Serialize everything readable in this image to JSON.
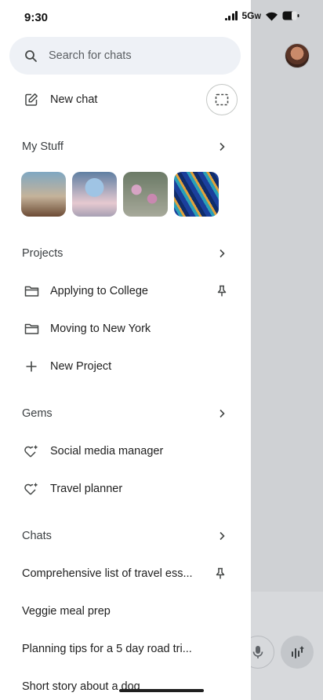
{
  "status_bar": {
    "time": "9:30",
    "network": "5G",
    "network_suffix": "W"
  },
  "search": {
    "placeholder": "Search for chats"
  },
  "new_chat": {
    "label": "New chat"
  },
  "my_stuff": {
    "title": "My Stuff",
    "thumbnails": [
      "hummingbird-image",
      "portrait-image",
      "flowers-image",
      "peacock-feather-image"
    ]
  },
  "projects": {
    "title": "Projects",
    "items": [
      {
        "label": "Applying to College",
        "pinned": true
      },
      {
        "label": "Moving to New York",
        "pinned": false
      }
    ],
    "new_label": "New Project"
  },
  "gems": {
    "title": "Gems",
    "items": [
      {
        "label": "Social media manager"
      },
      {
        "label": "Travel planner"
      }
    ]
  },
  "chats": {
    "title": "Chats",
    "items": [
      {
        "label": "Comprehensive list of travel ess...",
        "pinned": true
      },
      {
        "label": "Veggie meal prep",
        "pinned": false
      },
      {
        "label": "Planning tips for a 5 day road tri...",
        "pinned": false
      },
      {
        "label": "Short story about a dog",
        "pinned": false
      }
    ]
  },
  "colors": {
    "drawer_bg": "#ffffff",
    "search_bg": "#eef1f6",
    "scrim": "#cfd1d4",
    "text": "#1f1f1f"
  }
}
